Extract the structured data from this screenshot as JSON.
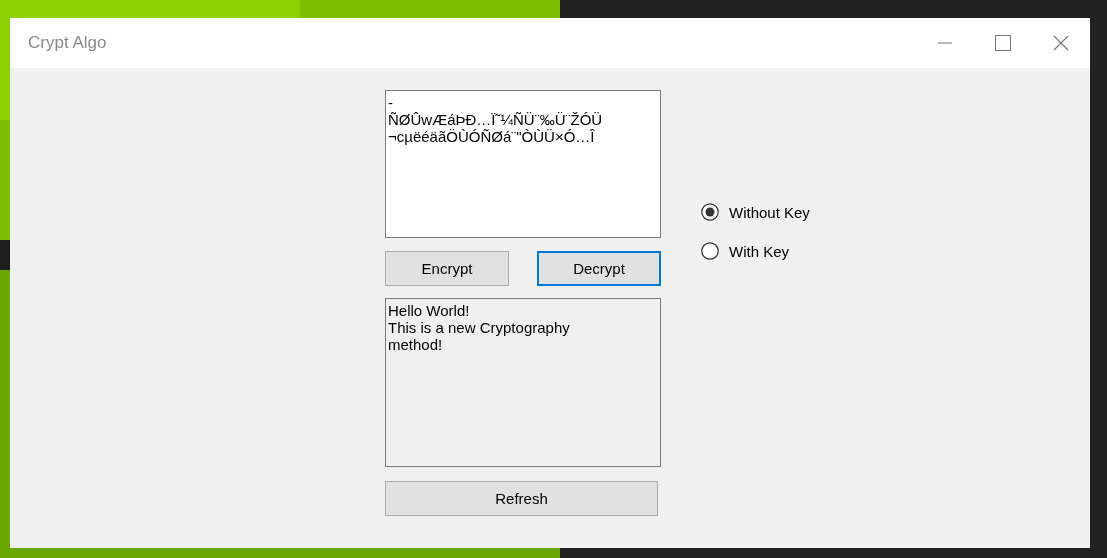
{
  "window": {
    "title": "Crypt Algo"
  },
  "input_box": {
    "value": "-\nÑØÛwÆáÞÐ…Ï˜¼ÑÜ¨‰Ü¨ŽÓÜ\n¬cµëéäãÖÙÓÑØá¨\"ÒÙÜ×Ó…Î"
  },
  "buttons": [
    {
      "label": "Encrypt",
      "focused": false
    },
    {
      "label": "Decrypt",
      "focused": true
    }
  ],
  "output_box": {
    "value": "Hello World!\nThis is a new Cryptography\nmethod!"
  },
  "refresh_button": {
    "label": "Refresh"
  },
  "options": [
    {
      "label": "Without Key",
      "selected": true
    },
    {
      "label": "With Key",
      "selected": false
    }
  ]
}
